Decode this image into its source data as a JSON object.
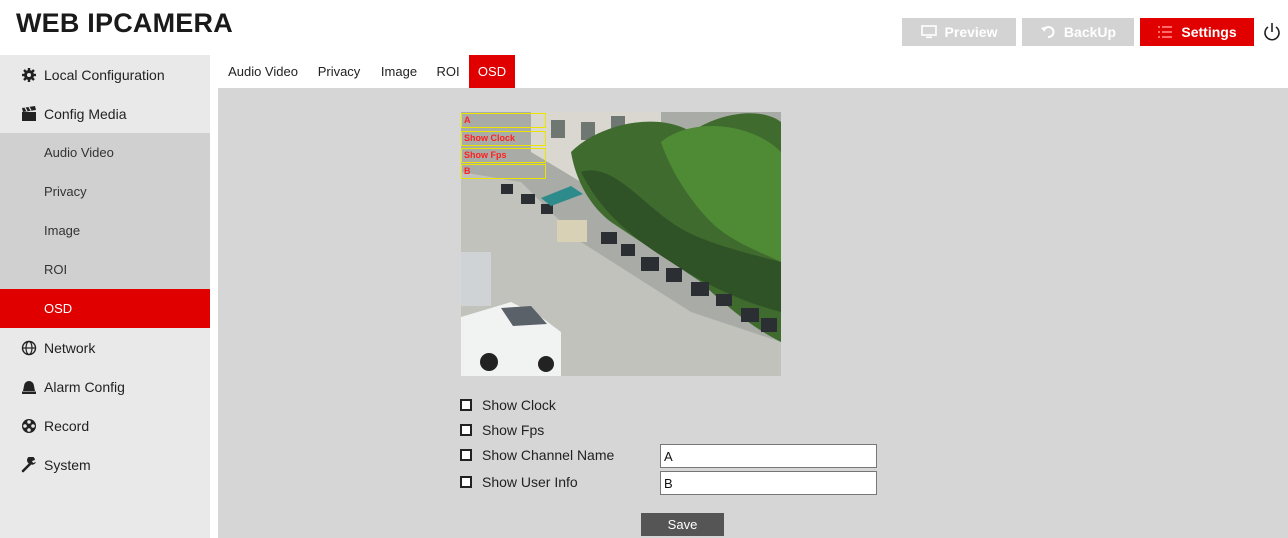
{
  "header": {
    "title": "WEB IPCAMERA",
    "buttons": [
      {
        "label": "Preview",
        "icon": "monitor-icon"
      },
      {
        "label": "BackUp",
        "icon": "undo-icon"
      },
      {
        "label": "Settings",
        "icon": "list-icon"
      }
    ],
    "power_icon": "power-icon"
  },
  "sidebar": {
    "items": [
      {
        "label": "Local Configuration",
        "icon": "gear-icon"
      },
      {
        "label": "Config Media",
        "icon": "clapperboard-icon"
      },
      {
        "label": "Network",
        "icon": "globe-icon"
      },
      {
        "label": "Alarm Config",
        "icon": "bell-icon"
      },
      {
        "label": "Record",
        "icon": "film-reel-icon"
      },
      {
        "label": "System",
        "icon": "wrench-icon"
      }
    ],
    "sub_items": [
      {
        "label": "Audio Video"
      },
      {
        "label": "Privacy"
      },
      {
        "label": "Image"
      },
      {
        "label": "ROI"
      },
      {
        "label": "OSD"
      }
    ]
  },
  "tabs": [
    {
      "label": "Audio Video"
    },
    {
      "label": "Privacy"
    },
    {
      "label": "Image"
    },
    {
      "label": "ROI"
    },
    {
      "label": "OSD"
    }
  ],
  "osd": {
    "overlay_texts": [
      "A",
      "Show Clock",
      "Show Fps",
      "B"
    ],
    "options": [
      {
        "label": "Show Clock",
        "checked": false
      },
      {
        "label": "Show Fps",
        "checked": false
      },
      {
        "label": "Show Channel Name",
        "checked": false,
        "value": "A"
      },
      {
        "label": "Show User Info",
        "checked": false,
        "value": "B"
      }
    ],
    "save_label": "Save"
  },
  "colors": {
    "accent": "#e00000",
    "header_button_grey": "#d3d3d3",
    "sidebar_bg": "#e9e9e9",
    "submenu_bg": "#d0d0d0",
    "main_bg": "#d6d6d6",
    "save_button": "#555555",
    "osd_box_border": "#e9e400"
  }
}
